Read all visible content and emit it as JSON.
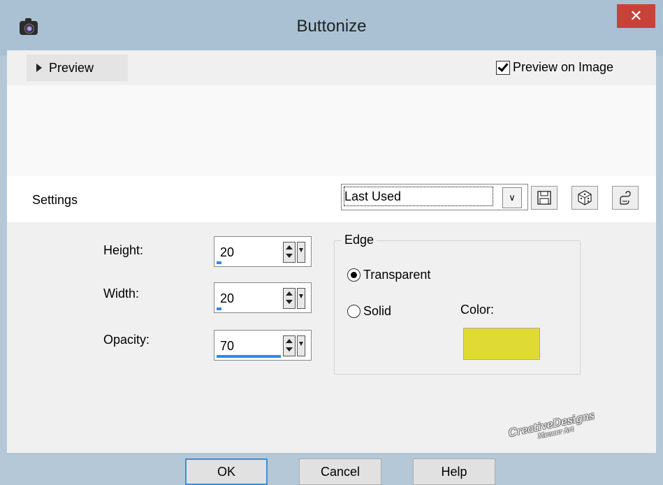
{
  "window": {
    "title": "Buttonize",
    "close_glyph": "✕"
  },
  "preview": {
    "toggle_label": "Preview",
    "preview_on_image_label": "Preview on Image",
    "preview_on_image_checked": true
  },
  "settings": {
    "label": "Settings",
    "preset_value": "Last Used",
    "tools": [
      "save-icon",
      "randomize-dice-icon",
      "reset-hand-icon"
    ]
  },
  "fields": {
    "height": {
      "label": "Height:",
      "value": "20",
      "fill_fraction": 0.05
    },
    "width": {
      "label": "Width:",
      "value": "20",
      "fill_fraction": 0.05
    },
    "opacity": {
      "label": "Opacity:",
      "value": "70",
      "fill_fraction": 0.7
    }
  },
  "edge": {
    "legend": "Edge",
    "options": [
      {
        "label": "Transparent",
        "checked": true
      },
      {
        "label": "Solid",
        "checked": false
      }
    ],
    "color_label": "Color:",
    "color_value": "#e0da35"
  },
  "buttons": {
    "ok": "OK",
    "cancel": "Cancel",
    "help": "Help"
  },
  "watermark": {
    "line1": "CreativeDesigns",
    "line2": "Meneer Art"
  },
  "colors": {
    "titlebar": "#a9c1d3",
    "close": "#c7433a",
    "accent": "#2a8ae6"
  }
}
